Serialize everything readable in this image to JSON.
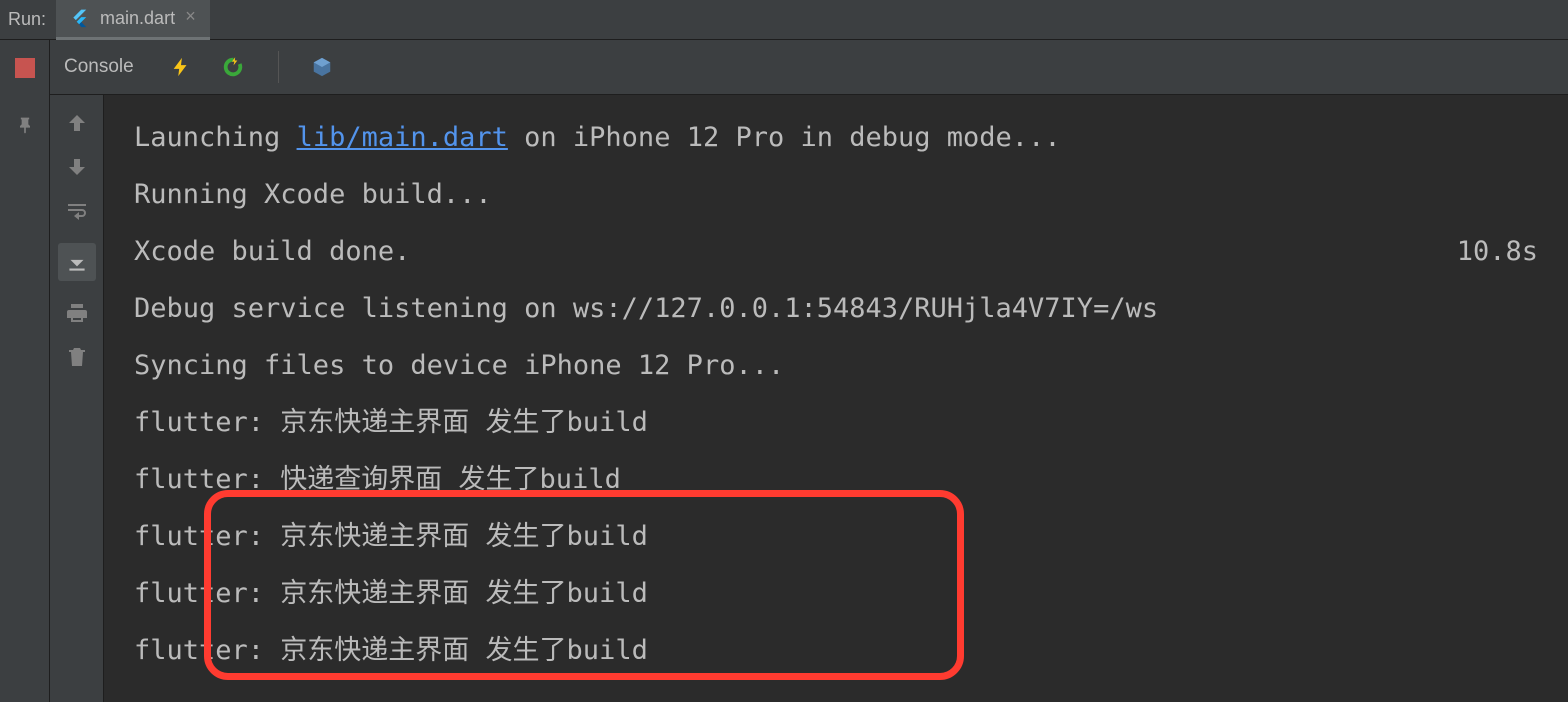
{
  "header": {
    "run_label": "Run:",
    "tab_label": "main.dart"
  },
  "toolbar": {
    "console_label": "Console"
  },
  "output": {
    "line1_prefix": "Launching ",
    "line1_link": "lib/main.dart",
    "line1_suffix": " on iPhone 12 Pro in debug mode...",
    "line2": "Running Xcode build...",
    "line3_text": "Xcode build done.",
    "line3_time": "10.8s",
    "line4": "Debug service listening on ws://127.0.0.1:54843/RUHjla4V7IY=/ws",
    "line5": "Syncing files to device iPhone 12 Pro...",
    "line6": "flutter: 京东快递主界面 发生了build",
    "line7": "flutter: 快递查询界面 发生了build",
    "line8": "flutter: 京东快递主界面 发生了build",
    "line9": "flutter: 京东快递主界面 发生了build",
    "line10": "flutter: 京东快递主界面 发生了build"
  }
}
